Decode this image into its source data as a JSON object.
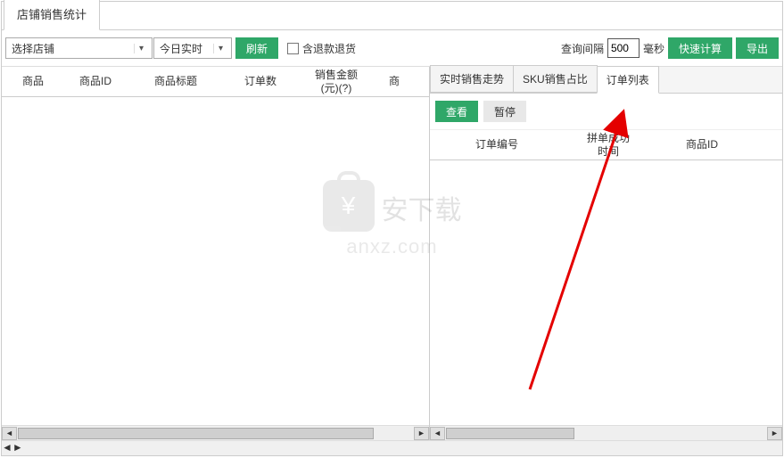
{
  "topTab": "店铺销售统计",
  "shopSelect": {
    "placeholder": "选择店铺"
  },
  "timeSelect": {
    "value": "今日实时"
  },
  "refreshBtn": "刷新",
  "includeRefund": "含退款退货",
  "intervalLabel": "查询间隔",
  "intervalValue": "500",
  "intervalUnit": "毫秒",
  "fastCalc": "快速计算",
  "exportBtn": "导出",
  "leftCols": [
    "商品",
    "商品ID",
    "商品标题",
    "订单数",
    "销售金额\n(元)(?)",
    "商"
  ],
  "rightTabs": [
    "实时销售走势",
    "SKU销售占比",
    "订单列表"
  ],
  "activeRightTab": 2,
  "viewBtn": "查看",
  "pauseBtn": "暂停",
  "rightCols": [
    "订单编号",
    "拼单成功\n时间",
    "商品ID"
  ],
  "watermark": {
    "cn": "安下载",
    "en": "anxz.com",
    "yen": "¥"
  }
}
